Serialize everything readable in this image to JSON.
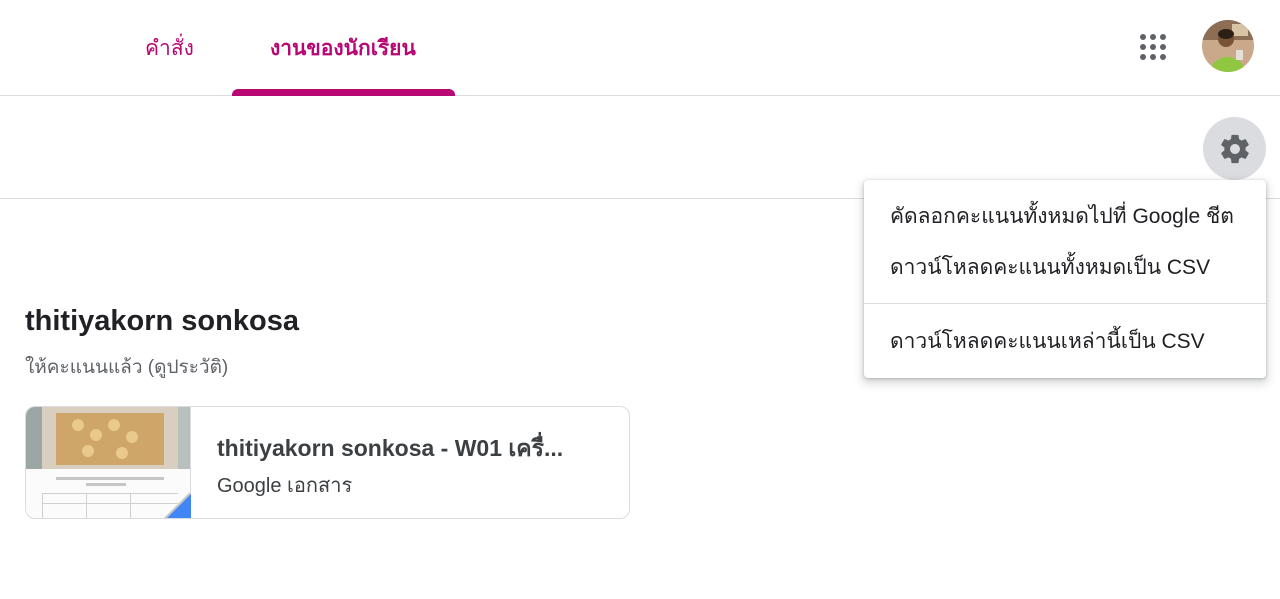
{
  "tabs": {
    "instructions": "คำสั่ง",
    "student_work": "งานของนักเรียน"
  },
  "student": {
    "name": "thitiyakorn sonkosa",
    "status": "ให้คะแนนแล้ว",
    "history_link": "(ดูประวัติ)"
  },
  "attachment": {
    "title": "thitiyakorn sonkosa - W01 เครื่...",
    "type": "Google เอกสาร"
  },
  "menu": {
    "items": [
      "คัดลอกคะแนนทั้งหมดไปที่ Google ชีต",
      "ดาวน์โหลดคะแนนทั้งหมดเป็น CSV",
      "ดาวน์โหลดคะแนนเหล่านี้เป็น CSV"
    ]
  },
  "icons": {
    "apps": "apps-grid-icon",
    "settings": "gear-icon",
    "docs_badge": "google-docs-corner-icon"
  },
  "colors": {
    "accent": "#b80672",
    "docs_blue": "#4285f4",
    "divider": "#dadce0"
  }
}
